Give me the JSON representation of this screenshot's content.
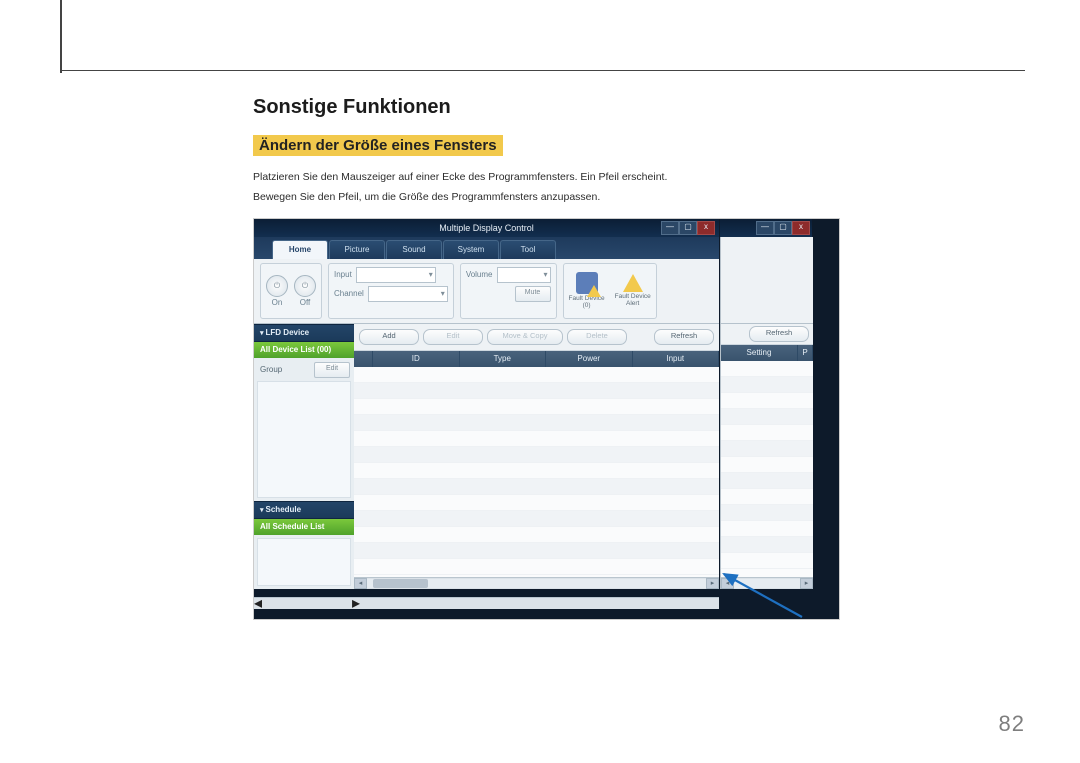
{
  "page": {
    "section_title": "Sonstige Funktionen",
    "sub_heading": "Ändern der Größe eines Fensters",
    "para1": "Platzieren Sie den Mauszeiger auf einer Ecke des Programmfensters. Ein Pfeil erscheint.",
    "para2": "Bewegen Sie den Pfeil, um die Größe des Programmfensters anzupassen.",
    "page_number": "82"
  },
  "colors": {
    "highlight": "#f2c94c",
    "accent_blue": "#1e70c1",
    "side_green": "#5db436"
  },
  "app": {
    "title": "Multiple Display Control",
    "win_controls": {
      "min": "—",
      "max": "▢",
      "close": "x"
    },
    "help": "?",
    "tabs": [
      "Home",
      "Picture",
      "Sound",
      "System",
      "Tool"
    ],
    "active_tab": "Home",
    "power": {
      "on_label": "On",
      "off_label": "Off"
    },
    "input_group": {
      "label": "Input",
      "channel_label": "Channel"
    },
    "volume_group": {
      "label": "Volume",
      "mute_btn": "Mute"
    },
    "fault": {
      "device_label": "Fault Device",
      "device_count": "(0)",
      "alert_label": "Fault Device\nAlert"
    },
    "actions": {
      "add": "Add",
      "edit": "Edit",
      "move_copy": "Move & Copy",
      "delete": "Delete",
      "refresh": "Refresh"
    },
    "columns": [
      "",
      "ID",
      "Type",
      "Power",
      "Input"
    ],
    "columns2": [
      "Setting",
      "P"
    ],
    "side": {
      "lfd_header": "LFD Device",
      "all_devices": "All Device List (00)",
      "group_label": "Group",
      "edit_btn": "Edit",
      "schedule_header": "Schedule",
      "all_schedule": "All Schedule List"
    }
  }
}
